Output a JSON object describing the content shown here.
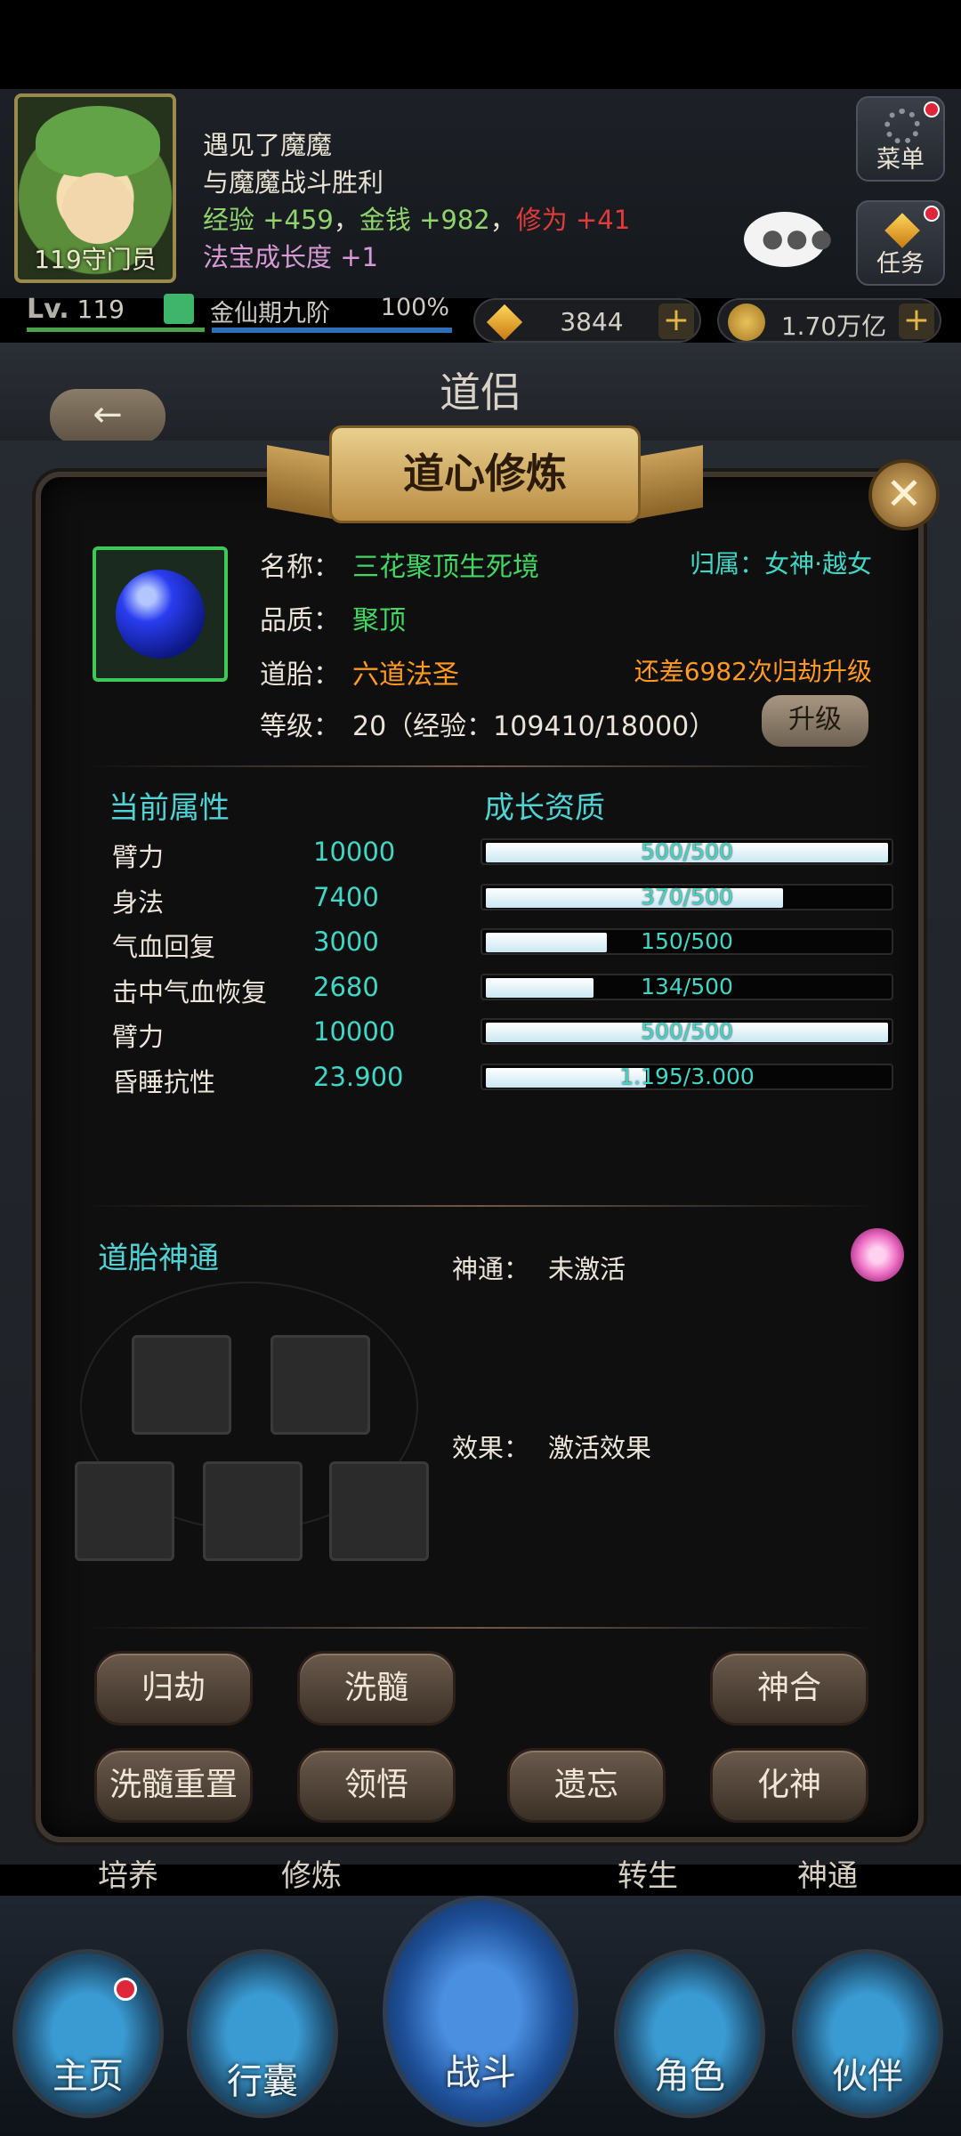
{
  "player": {
    "title": "119守门员",
    "level_prefix": "Lv.",
    "level": "119",
    "realm": "金仙期九阶",
    "realm_progress": "100%",
    "gems": "3844",
    "gold": "1.70万亿"
  },
  "log": {
    "line1": "遇见了魔魔",
    "line2": "与魔魔战斗胜利",
    "exp": "经验 +459",
    "sep1": "，",
    "money": "金钱 +982",
    "sep2": "，",
    "cultivation": "修为 +41",
    "treasure": "法宝成长度 +1"
  },
  "side_buttons": {
    "menu": "菜单",
    "task": "任务"
  },
  "page": {
    "title": "道侣",
    "back": "←"
  },
  "dialog": {
    "banner": "道心修炼",
    "close": "✕",
    "name_label": "名称：",
    "name": "三花聚顶生死境",
    "affiliation": "归属：女神·越女",
    "quality_label": "品质：",
    "quality": "聚顶",
    "embryo_label": "道胎：",
    "embryo": "六道法圣",
    "needs": "还差6982次归劫升级",
    "level_label": "等级：",
    "level": "20（经验：109410/18000）",
    "upgrade": "升级",
    "current_attr_title": "当前属性",
    "growth_title": "成长资质",
    "attributes": [
      {
        "name": "臂力",
        "value": "10000",
        "growth": "500/500",
        "ratio": 1.0
      },
      {
        "name": "身法",
        "value": "7400",
        "growth": "370/500",
        "ratio": 0.74
      },
      {
        "name": "气血回复",
        "value": "3000",
        "growth": "150/500",
        "ratio": 0.3
      },
      {
        "name": "击中气血恢复",
        "value": "2680",
        "growth": "134/500",
        "ratio": 0.268
      },
      {
        "name": "臂力",
        "value": "10000",
        "growth": "500/500",
        "ratio": 1.0
      },
      {
        "name": "昏睡抗性",
        "value": "23.900",
        "growth": "1.195/3.000",
        "ratio": 0.398
      }
    ],
    "divine_title": "道胎神通",
    "divine_label": "神通：",
    "divine_value": "未激活",
    "effect_label": "效果：",
    "effect_value": "激活效果"
  },
  "actions": {
    "guijie": "归劫",
    "xisui": "洗髓",
    "shenhe": "神合",
    "xisui_reset": "洗髓重置",
    "lingwu": "领悟",
    "yiwang": "遗忘",
    "huashen": "化神"
  },
  "sub_tabs": [
    "培养",
    "修炼",
    "转生",
    "神通"
  ],
  "nav": [
    "主页",
    "行囊",
    "战斗",
    "角色",
    "伙伴"
  ],
  "colors": {
    "accent_cyan": "#3fd8c7",
    "accent_green": "#42d663",
    "accent_orange": "#ff9a1f"
  }
}
